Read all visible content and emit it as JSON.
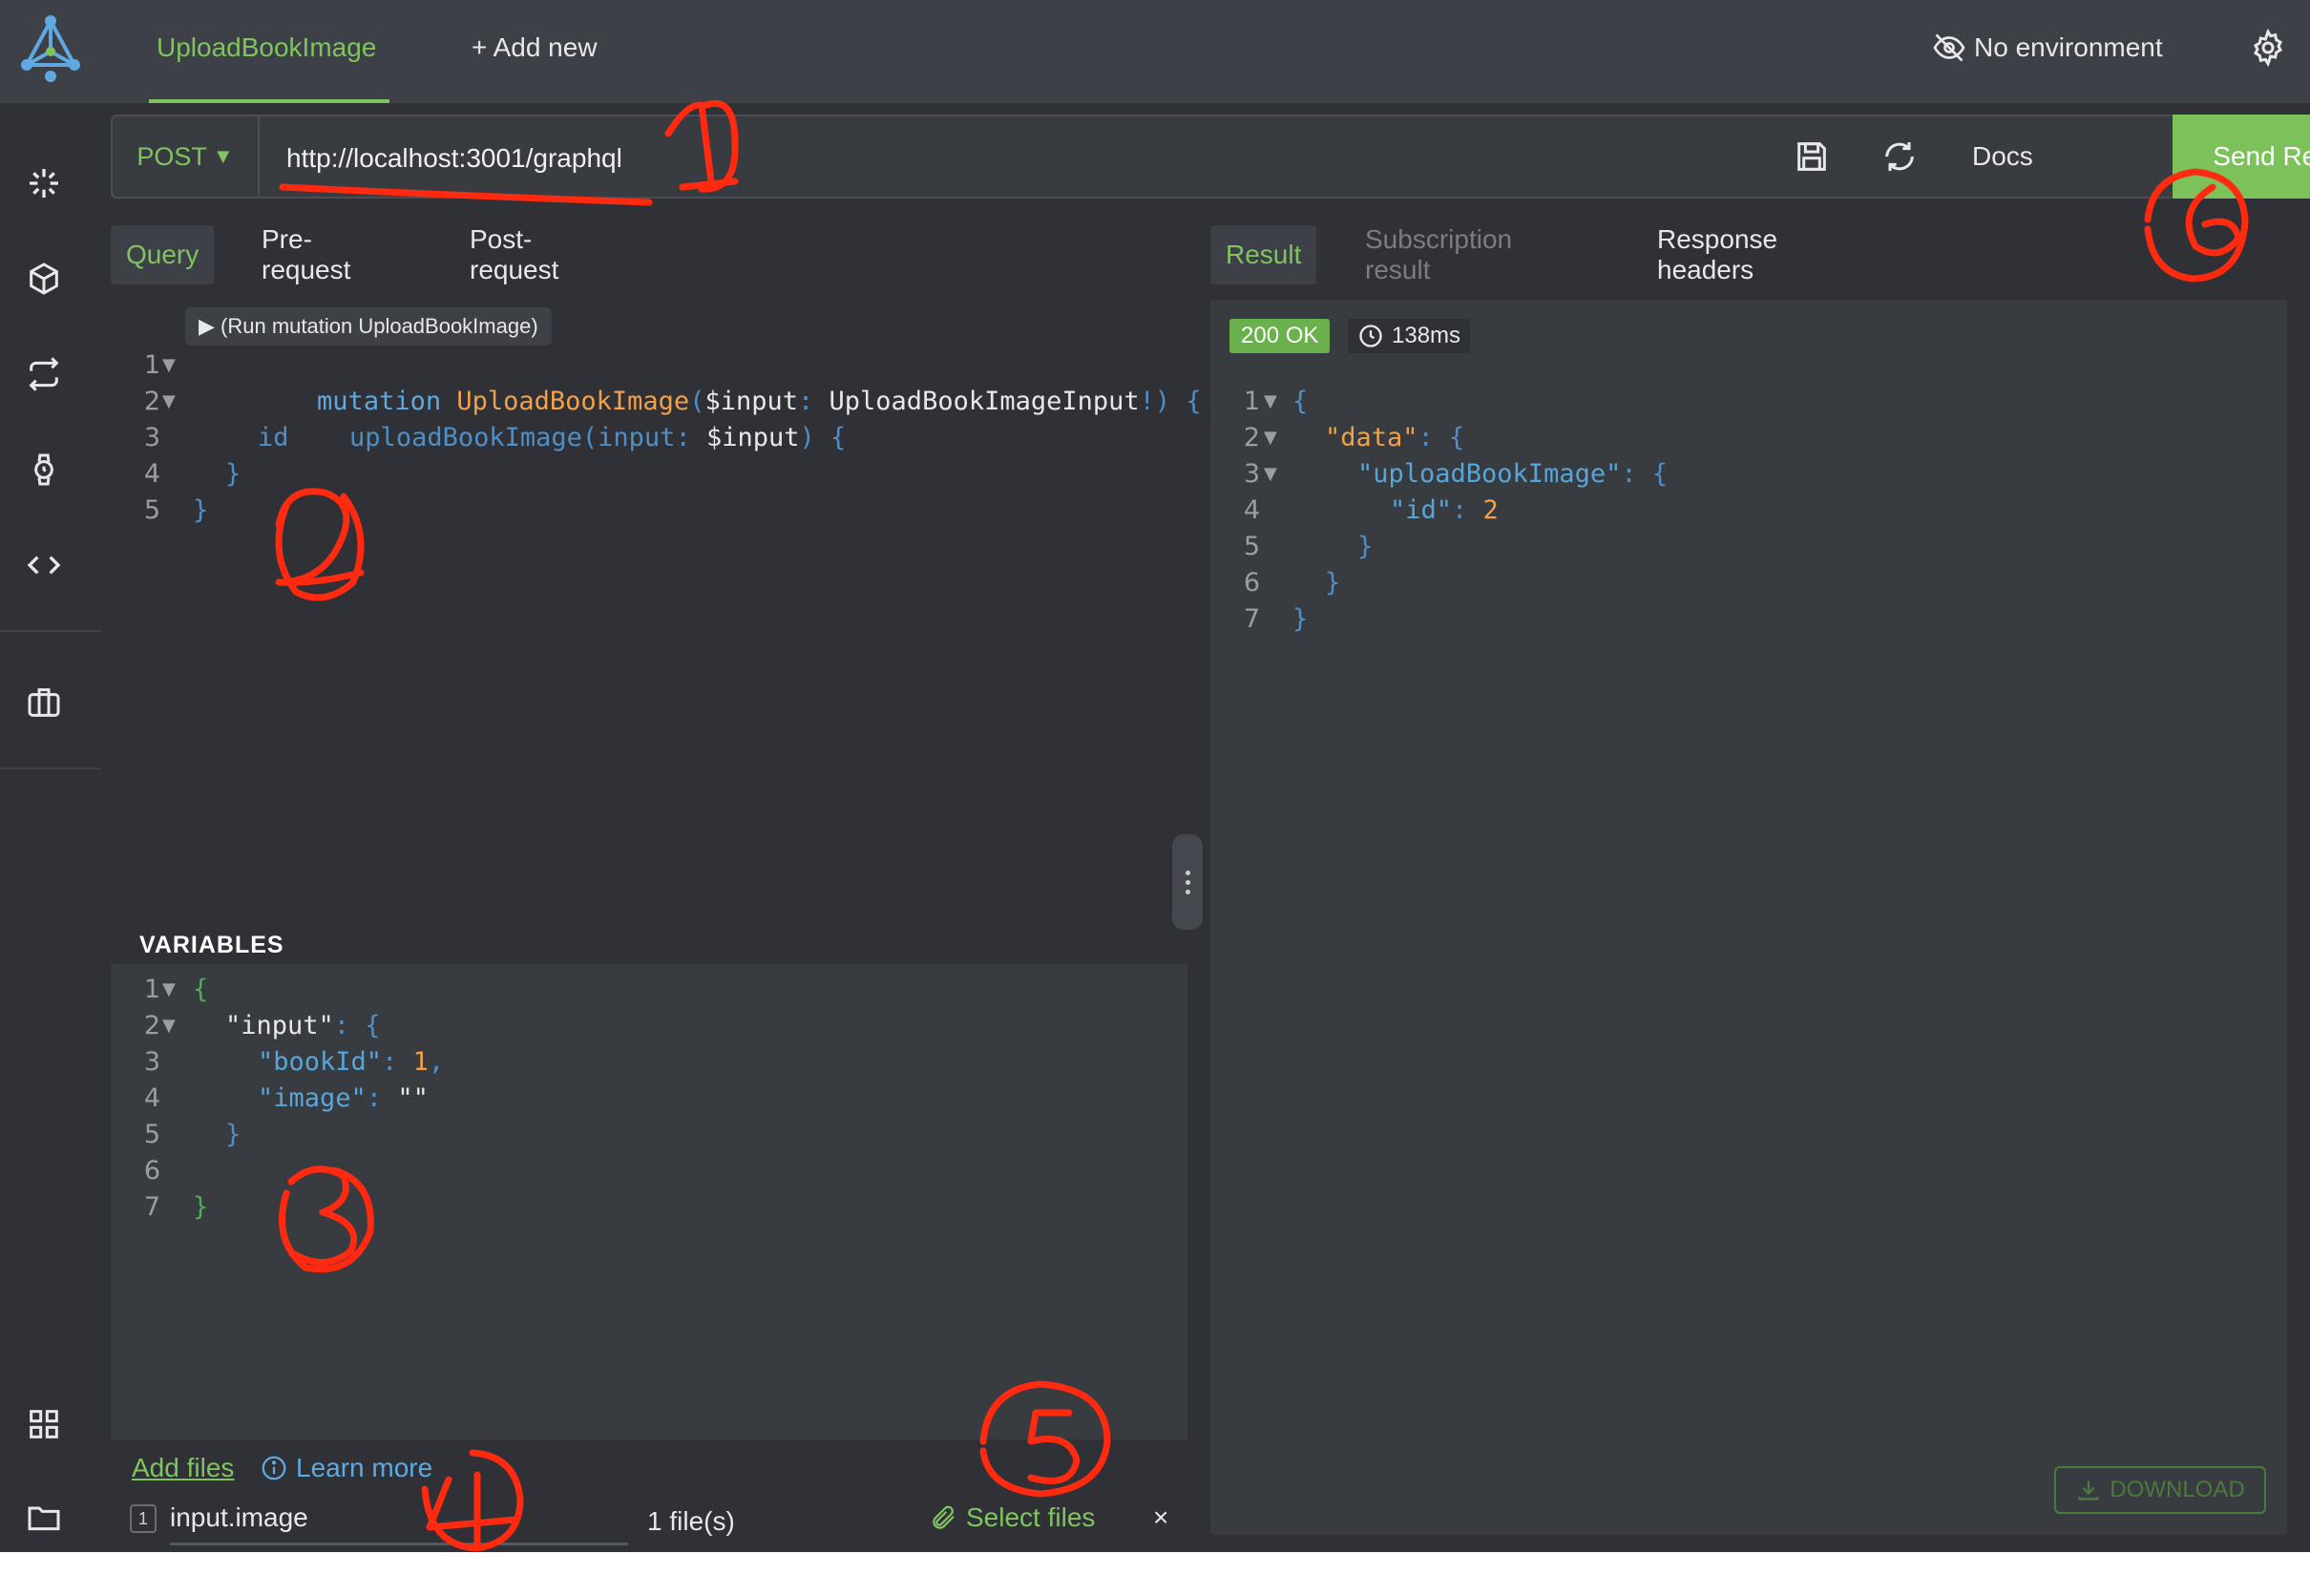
{
  "colors": {
    "accent": "#7fc45f",
    "annotation": "#ff2a10",
    "send_button": "#7cc15a"
  },
  "header": {
    "active_tab": "UploadBookImage",
    "add_new": "+ Add new",
    "environment": "No environment"
  },
  "request": {
    "method": "POST",
    "url": "http://localhost:3001/graphql",
    "docs": "Docs",
    "send": "Send Request"
  },
  "query_tabs": [
    "Query",
    "Pre-request",
    "Post-request"
  ],
  "run_mutation": "▶ (Run mutation UploadBookImage)",
  "query_lines": {
    "l1": {
      "kw": "mutation",
      "name": "UploadBookImage",
      "paren": "(",
      "var": "$input",
      "colon": ": ",
      "type": "UploadBookImageInput",
      "bang": "!)",
      "brace": " {"
    },
    "l2": {
      "fn": "uploadBookImage",
      "paren": "(",
      "arg": "input",
      "colon": ": ",
      "var": "$input",
      "close": ")",
      "brace": " {"
    },
    "l3": "id",
    "l4": "}",
    "l5": "}"
  },
  "variables": {
    "label": "VARIABLES",
    "l1": "{",
    "l2_key": "\"input\"",
    "l2_rest": ": {",
    "l3_key": "\"bookId\"",
    "l3_colon": ": ",
    "l3_val": "1",
    "l3_comma": ",",
    "l4_key": "\"image\"",
    "l4_colon": ": ",
    "l4_val": "\"\"",
    "l5": "}",
    "l7": "}"
  },
  "result_tabs": [
    "Result",
    "Subscription result",
    "Response headers"
  ],
  "result": {
    "status": "200 OK",
    "time": "138ms",
    "l1": "{",
    "l2_key": "\"data\"",
    "l2_rest": ": {",
    "l3_key": "\"uploadBookImage\"",
    "l3_rest": ": {",
    "l4_key": "\"id\"",
    "l4_colon": ": ",
    "l4_val": "2",
    "l5": "}",
    "l6": "}",
    "l7": "}",
    "download": "DOWNLOAD"
  },
  "files": {
    "add_files": "Add files",
    "learn_more": "Learn more",
    "index": "1",
    "file_name": "input.image",
    "count": "1 file(s)",
    "select_files": "Select files",
    "close": "×"
  },
  "line_numbers": [
    "1",
    "2",
    "3",
    "4",
    "5",
    "6",
    "7"
  ],
  "annotations": [
    "1",
    "2",
    "3",
    "4",
    "5",
    "6"
  ]
}
